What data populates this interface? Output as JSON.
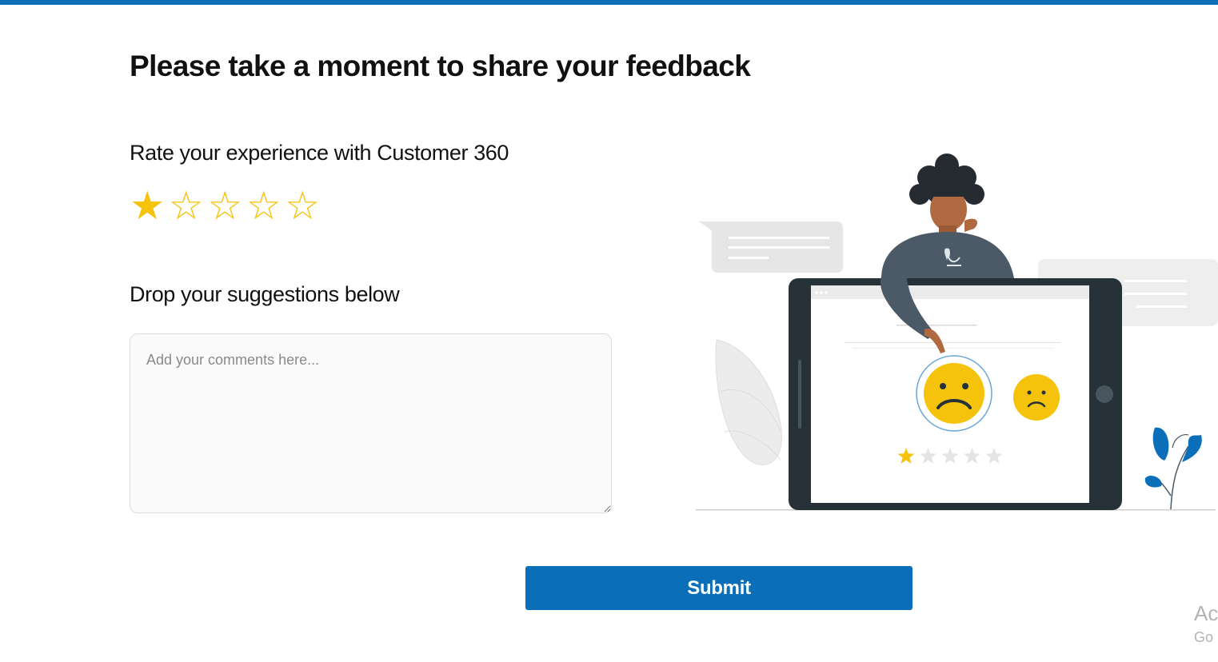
{
  "header": {
    "title": "Please take a moment to share your feedback"
  },
  "rating": {
    "label": "Rate your experience with Customer 360",
    "value": 1,
    "max": 5,
    "filled_symbol": "★",
    "empty_symbol": "☆",
    "color": "#f5c30c"
  },
  "suggestions": {
    "label": "Drop your suggestions below",
    "placeholder": "Add your comments here...",
    "value": ""
  },
  "illustration": {
    "icon": "feedback-illustration",
    "screen_rating": 1,
    "screen_rating_max": 5
  },
  "submit": {
    "label": "Submit"
  },
  "watermark": {
    "title": "Ac",
    "subtitle": "Go"
  },
  "colors": {
    "accent": "#0a6fb8",
    "star": "#f5c30c",
    "emoji": "#f5c30c",
    "text": "#111111"
  }
}
